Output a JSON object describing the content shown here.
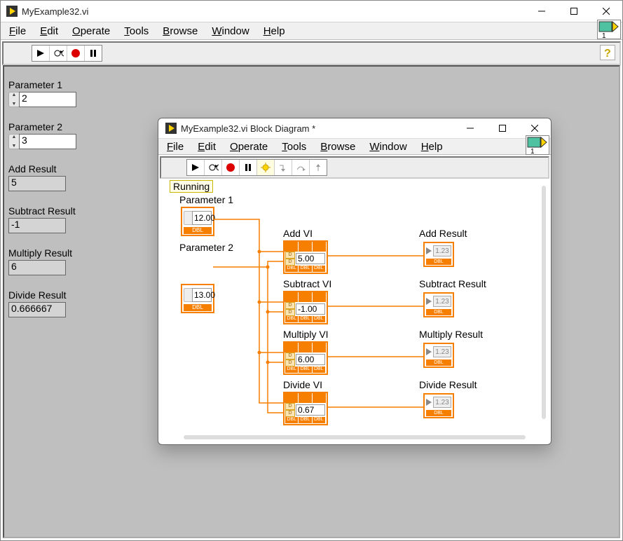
{
  "main_window": {
    "title": "MyExample32.vi",
    "menu": [
      "File",
      "Edit",
      "Operate",
      "Tools",
      "Browse",
      "Window",
      "Help"
    ],
    "controls": [
      {
        "label": "Parameter 1",
        "value": "2",
        "type": "control"
      },
      {
        "label": "Parameter 2",
        "value": "3",
        "type": "control"
      },
      {
        "label": "Add Result",
        "value": "5",
        "type": "indicator"
      },
      {
        "label": "Subtract Result",
        "value": "-1",
        "type": "indicator"
      },
      {
        "label": "Multiply Result",
        "value": "6",
        "type": "indicator"
      },
      {
        "label": "Divide Result",
        "value": "0.666667",
        "type": "indicator"
      }
    ],
    "conn_pane_number": "1"
  },
  "diagram_window": {
    "title": "MyExample32.vi Block Diagram *",
    "menu": [
      "File",
      "Edit",
      "Operate",
      "Tools",
      "Browse",
      "Window",
      "Help"
    ],
    "status_badge": "Running",
    "conn_pane_number": "1",
    "controls": [
      {
        "label": "Parameter 1",
        "value": "12.00",
        "tag": "DBL"
      },
      {
        "label": "Parameter 2",
        "value": "13.00",
        "tag": "DBL"
      }
    ],
    "subvis": [
      {
        "label": "Add VI",
        "value": "5.00"
      },
      {
        "label": "Subtract VI",
        "value": "-1.00"
      },
      {
        "label": "Multiply VI",
        "value": "6.00"
      },
      {
        "label": "Divide VI",
        "value": "0.67"
      }
    ],
    "indicators": [
      {
        "label": "Add Result",
        "value": "1.23",
        "tag": "DBL"
      },
      {
        "label": "Subtract Result",
        "value": "1.23",
        "tag": "DBL"
      },
      {
        "label": "Multiply Result",
        "value": "1.23",
        "tag": "DBL"
      },
      {
        "label": "Divide Result",
        "value": "1.23",
        "tag": "DBL"
      }
    ]
  }
}
